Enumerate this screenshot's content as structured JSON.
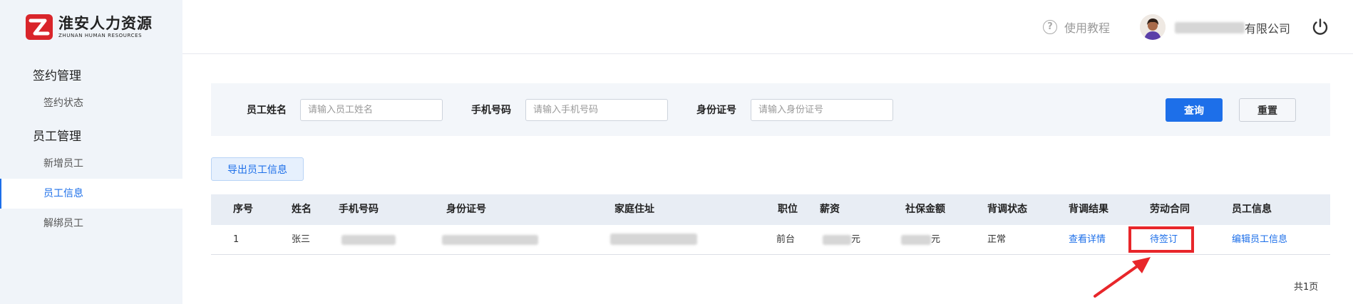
{
  "brand": {
    "name_cn": "淮安人力资源",
    "name_en": "ZHUNAN HUMAN RESOURCES"
  },
  "sidebar": {
    "groups": [
      {
        "label": "签约管理",
        "items": [
          {
            "label": "签约状态"
          }
        ]
      },
      {
        "label": "员工管理",
        "items": [
          {
            "label": "新增员工"
          },
          {
            "label": "员工信息",
            "active": true
          },
          {
            "label": "解绑员工"
          }
        ]
      }
    ]
  },
  "header": {
    "help_label": "使用教程",
    "company_suffix": "有限公司"
  },
  "search": {
    "name_label": "员工姓名",
    "name_placeholder": "请输入员工姓名",
    "phone_label": "手机号码",
    "phone_placeholder": "请输入手机号码",
    "id_label": "身份证号",
    "id_placeholder": "请输入身份证号",
    "query_label": "查询",
    "reset_label": "重置"
  },
  "export_label": "导出员工信息",
  "table": {
    "columns": [
      "序号",
      "姓名",
      "手机号码",
      "身份证号",
      "家庭住址",
      "职位",
      "薪资",
      "社保金额",
      "背调状态",
      "背调结果",
      "劳动合同",
      "员工信息"
    ],
    "rows": [
      {
        "index": "1",
        "name": "张三",
        "position": "前台",
        "salary_unit": "元",
        "social_unit": "元",
        "bg_status": "正常",
        "bg_result": "查看详情",
        "contract": "待签订",
        "employee_info": "编辑员工信息"
      }
    ]
  },
  "pager": {
    "text": "共1页"
  },
  "colors": {
    "accent": "#1d6fe9",
    "highlight": "#e8262a",
    "sidebar_bg": "#f0f4f9"
  },
  "icons": [
    "logo-mark",
    "help-circle-icon",
    "avatar",
    "power-icon",
    "arrow-annotation"
  ]
}
